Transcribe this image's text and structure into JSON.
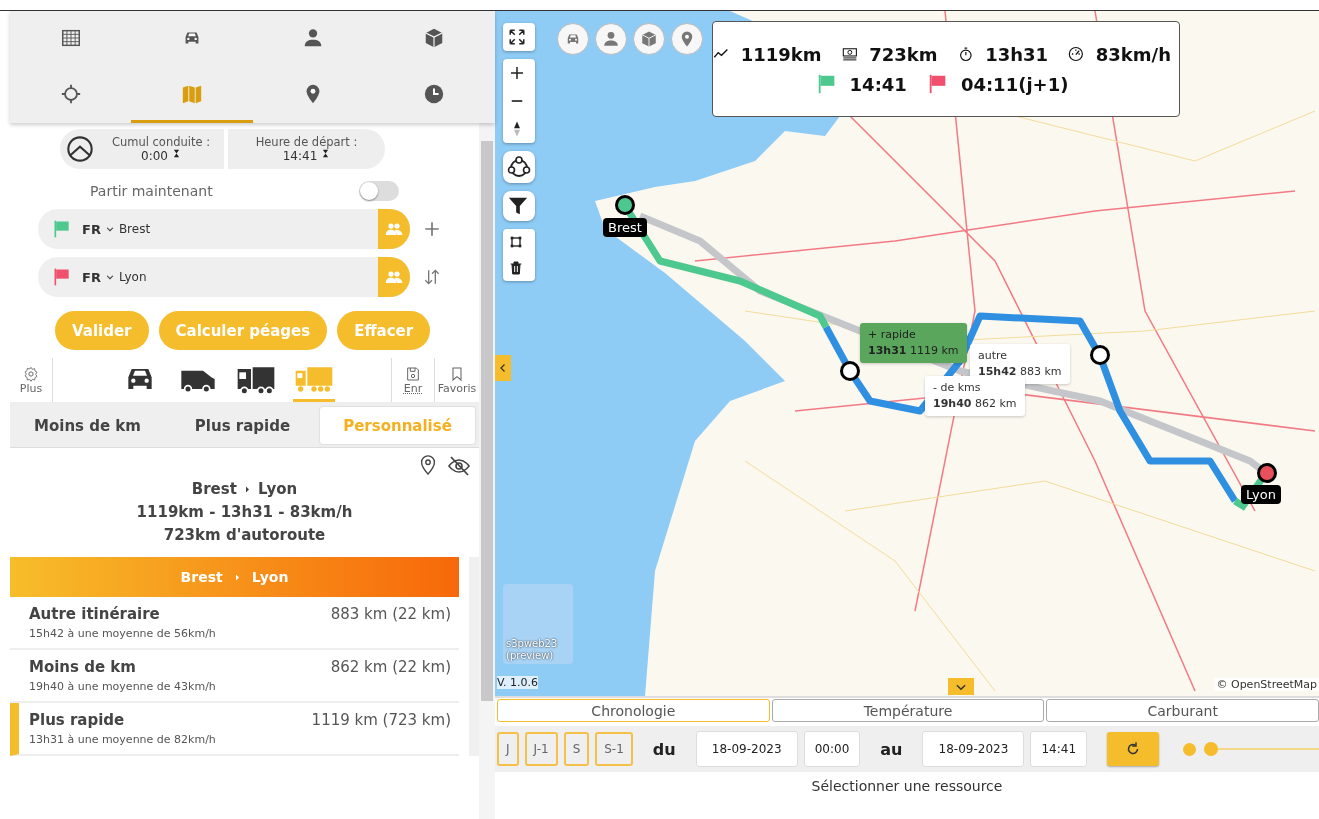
{
  "nav_tabs": [
    {
      "kind": "table",
      "selected": false
    },
    {
      "kind": "car",
      "selected": false
    },
    {
      "kind": "person",
      "selected": false
    },
    {
      "kind": "package",
      "selected": false
    },
    {
      "kind": "crosshair",
      "selected": false
    },
    {
      "kind": "map",
      "selected": true
    },
    {
      "kind": "pin",
      "selected": false
    },
    {
      "kind": "clock",
      "selected": false
    }
  ],
  "driving": {
    "label": "Cumul conduite :",
    "value": "0:00"
  },
  "departure": {
    "label": "Heure de départ :",
    "value": "14:41"
  },
  "leave_now": {
    "label": "Partir maintenant",
    "on": false
  },
  "stops": [
    {
      "country": "FR",
      "city": "Brest",
      "color": "#4dc88e",
      "kind": "add"
    },
    {
      "country": "FR",
      "city": "Lyon",
      "color": "#f0506e",
      "kind": "swap"
    }
  ],
  "buttons": [
    "Valider",
    "Calculer péages",
    "Effacer"
  ],
  "settings_label": "Plus",
  "vehicles": [
    {
      "kind": "car",
      "selected": false
    },
    {
      "kind": "van",
      "selected": false
    },
    {
      "kind": "truck",
      "selected": false
    },
    {
      "kind": "trailer",
      "selected": true
    }
  ],
  "save_label": "Enr",
  "favorites_label": "Favoris",
  "route_tabs": [
    {
      "label": "Moins de km",
      "selected": false
    },
    {
      "label": "Plus rapide",
      "selected": false
    },
    {
      "label": "Personnalisé",
      "selected": true
    }
  ],
  "summary": {
    "from": "Brest",
    "to": "Lyon",
    "stats": "1119km - 13h31 - 83km/h",
    "highway": "723km d'autoroute"
  },
  "itinerary_header": {
    "from": "Brest",
    "to": "Lyon"
  },
  "itineraries": [
    {
      "name": "Autre itinéraire",
      "distance": "883 km (22 km)",
      "detail": "15h42 à une moyenne de 56km/h",
      "selected": false
    },
    {
      "name": "Moins de km",
      "distance": "862 km (22 km)",
      "detail": "19h40 à une moyenne de 43km/h",
      "selected": false
    },
    {
      "name": "Plus rapide",
      "distance": "1119 km (723 km)",
      "detail": "13h31 à une moyenne de 82km/h",
      "selected": true
    }
  ],
  "map": {
    "filters": [
      {
        "kind": "car"
      },
      {
        "kind": "person"
      },
      {
        "kind": "package"
      },
      {
        "kind": "pin"
      }
    ],
    "trip": {
      "distance": "1119km",
      "highway": "723km",
      "duration": "13h31",
      "speed": "83km/h",
      "start": "14:41",
      "end": "04:11(j+1)"
    },
    "start_marker": "Brest",
    "end_marker": "Lyon",
    "route_labels": [
      {
        "title": "+ rapide",
        "time": "13h31",
        "distance": "1119 km",
        "selected": true
      },
      {
        "title": "autre",
        "time": "15h42",
        "distance": "883 km",
        "selected": false
      },
      {
        "title": "- de kms",
        "time": "19h40",
        "distance": "862 km",
        "selected": false
      }
    ],
    "layer_label": "s3pweb23 (preview)",
    "version": "V. 1.0.6",
    "attribution": "© OpenStreetMap"
  },
  "bottom_tabs": [
    {
      "label": "Chronologie",
      "selected": true
    },
    {
      "label": "Température",
      "selected": false
    },
    {
      "label": "Carburant",
      "selected": false
    }
  ],
  "periods": [
    "J",
    "J-1",
    "S",
    "S-1"
  ],
  "range": {
    "from_label": "du",
    "from_date": "18-09-2023",
    "from_time": "00:00",
    "to_label": "au",
    "to_date": "18-09-2023",
    "to_time": "14:41"
  },
  "timeline": {
    "level": 0.0
  },
  "message": "Sélectionner une ressource"
}
